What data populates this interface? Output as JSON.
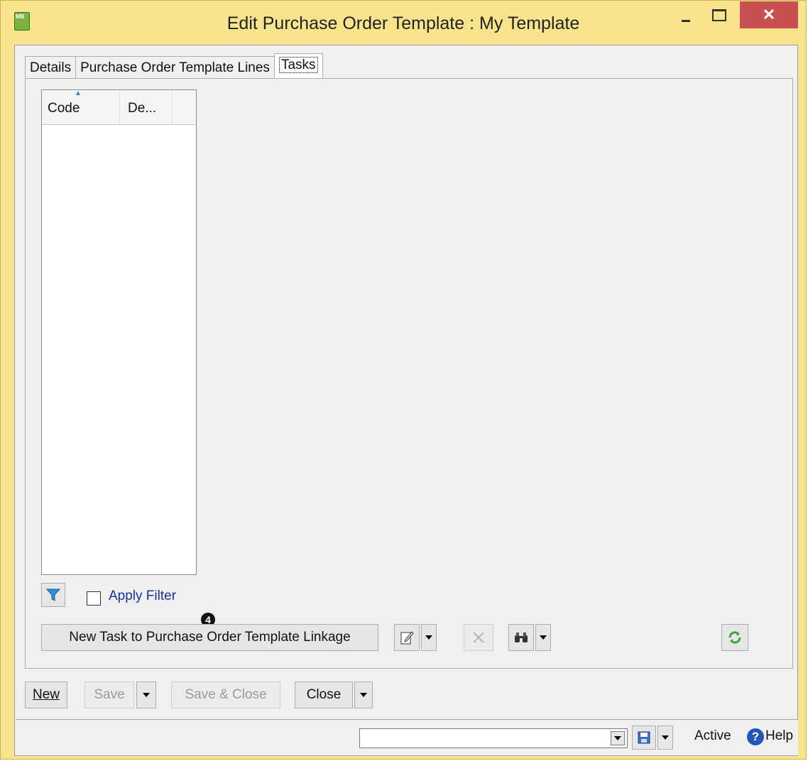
{
  "window": {
    "title": "Edit Purchase Order Template : My Template",
    "app_icon_text": "MB",
    "close_glyph": "✕"
  },
  "tabs": [
    {
      "label": "Details"
    },
    {
      "label": "Purchase Order Template Lines"
    },
    {
      "label": "Tasks",
      "active": true
    }
  ],
  "grid": {
    "columns": [
      "Code",
      "De..."
    ],
    "sort_indicator": "▲",
    "rows": []
  },
  "filter": {
    "apply_label": "Apply Filter",
    "checked": false
  },
  "badge": {
    "text": "4"
  },
  "toolbar": {
    "new_task_label": "New Task to Purchase Order Template Linkage",
    "edit_icon": "edit-icon",
    "delete_icon": "delete-icon",
    "find_icon": "binoculars-icon",
    "refresh_icon": "refresh-icon"
  },
  "bottom_buttons": {
    "new": "New",
    "save": "Save",
    "save_close": "Save & Close",
    "close": "Close"
  },
  "status": {
    "combo_value": "",
    "state_text": "Active",
    "help_text": "Help"
  },
  "colors": {
    "window_frame": "#F7E48D",
    "close_button": "#C75050",
    "filter_blue": "#2E8BD8",
    "refresh_green": "#3AA33A",
    "apply_filter_text": "#1A2F9E"
  }
}
